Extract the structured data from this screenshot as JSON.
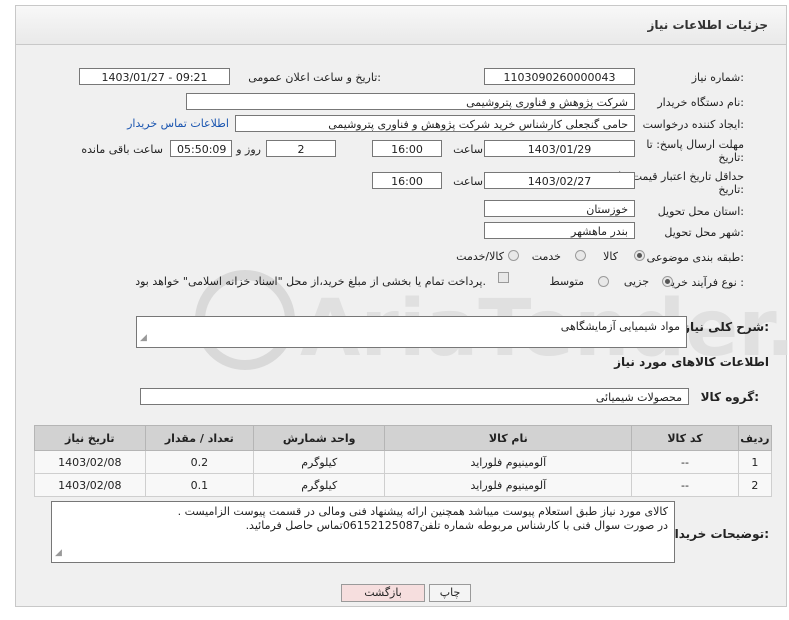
{
  "panel_title": "جزئیات اطلاعات نیاز",
  "need_number": {
    "label": "شماره نیاز:",
    "value": "1103090260000043"
  },
  "announce_datetime": {
    "label": "تاریخ و ساعت اعلان عمومی:",
    "value": "1403/01/27 - 09:21"
  },
  "buyer_org": {
    "label": "نام دستگاه خریدار:",
    "value": "شرکت پژوهش و فناوری پتروشیمی"
  },
  "requester": {
    "label": "ایجاد کننده درخواست:",
    "value": "حامی گنجعلی کارشناس خرید شرکت پژوهش و فناوری پتروشیمی",
    "contact_link": "اطلاعات تماس خریدار"
  },
  "reply_deadline": {
    "label_line1": "مهلت ارسال پاسخ: تا",
    "label_line2": "تاریخ:",
    "date": "1403/01/29",
    "time_label": "ساعت",
    "time": "16:00",
    "days": "2",
    "days_label": "روز و",
    "remaining": "05:50:09",
    "remaining_label": "ساعت باقی مانده"
  },
  "price_validity": {
    "label_line1": "حداقل تاریخ اعتبار قیمت: تا",
    "label_line2": "تاریخ:",
    "date": "1403/02/27",
    "time_label": "ساعت",
    "time": "16:00"
  },
  "delivery_province": {
    "label": "استان محل تحویل:",
    "value": "خوزستان"
  },
  "delivery_city": {
    "label": "شهر محل تحویل:",
    "value": "بندر ماهشهر"
  },
  "category": {
    "label": "طبقه بندی موضوعی:",
    "options": [
      "کالا",
      "خدمت",
      "کالا/خدمت"
    ],
    "selected": "کالا"
  },
  "purchase_process": {
    "label": "نوع فرآیند خرید :",
    "options": [
      "جزیی",
      "متوسط"
    ],
    "selected": "جزیی",
    "payment_note": "پرداخت تمام یا بخشی از مبلغ خرید،از محل \"اسناد خزانه اسلامی\" خواهد بود."
  },
  "description": {
    "label": "شرح کلی نیاز:",
    "value": "مواد شیمیایی آزمایشگاهی"
  },
  "goods_section_title": "اطلاعات کالاهای مورد نیاز",
  "goods_group": {
    "label": "گروه کالا:",
    "value": "محصولات شیمیائی"
  },
  "table": {
    "headers": [
      "ردیف",
      "کد کالا",
      "نام کالا",
      "واحد شمارش",
      "تعداد / مقدار",
      "تاریخ نیاز"
    ],
    "rows": [
      [
        "1",
        "--",
        "آلومینیوم فلوراید",
        "کیلوگرم",
        "0.2",
        "1403/02/08"
      ],
      [
        "2",
        "--",
        "آلومینیوم فلوراید",
        "کیلوگرم",
        "0.1",
        "1403/02/08"
      ]
    ]
  },
  "buyer_notes": {
    "label": "توضیحات خریدار:",
    "line1": "کالای مورد نیاز طبق استعلام پیوست میباشد همچنین ارائه پیشنهاد فنی ومالی در قسمت پیوست الزامیست .",
    "line2": "در صورت سوال فنی با کارشناس مربوطه شماره تلفن06152125087تماس حاصل فرمائید."
  },
  "buttons": {
    "print": "چاپ",
    "back": "بازگشت"
  },
  "colors": {
    "link": "#1a55b0",
    "header_bg": "#e9e9e9",
    "table_header": "#d2d2d2",
    "back_button": "#f6dede"
  }
}
